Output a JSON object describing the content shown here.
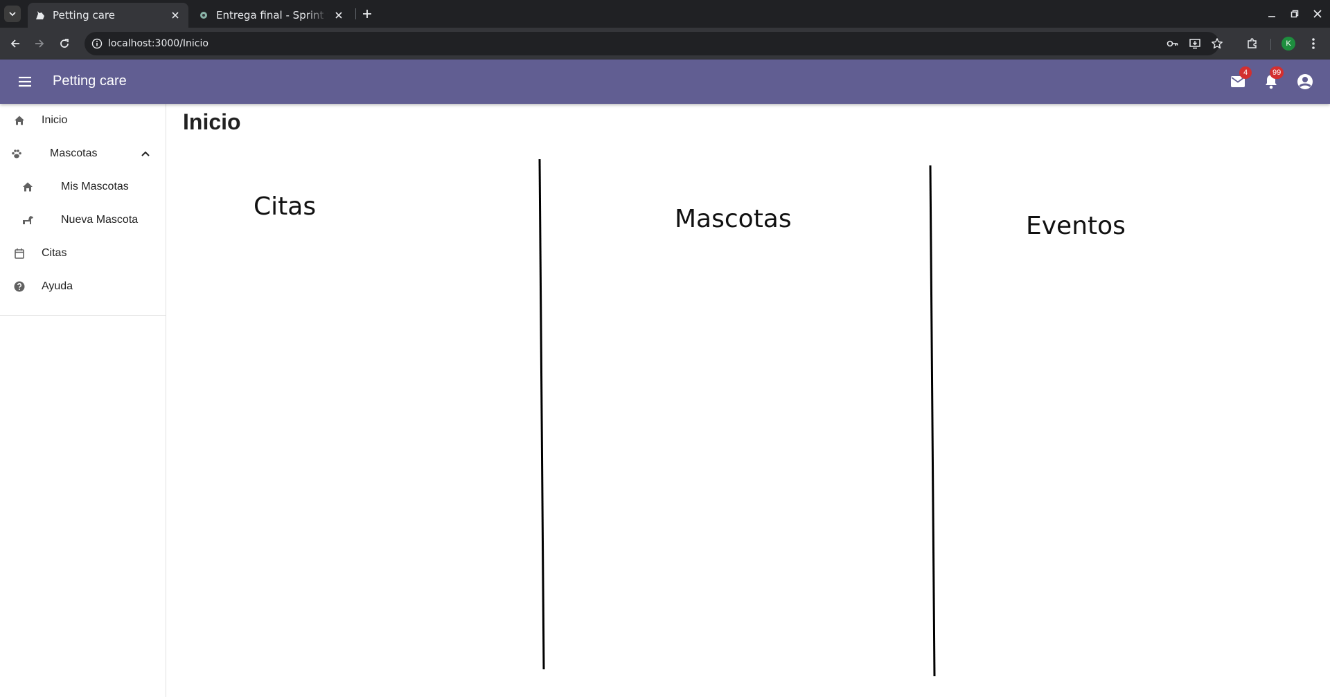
{
  "browser": {
    "tabs": [
      {
        "title": "Petting care",
        "active": true
      },
      {
        "title": "Entrega final - Sprint tas",
        "active": false
      }
    ],
    "url": "localhost:3000/Inicio",
    "profile_initial": "K"
  },
  "appbar": {
    "title": "Petting care",
    "background": "#615e92",
    "mail_badge": "4",
    "notifications_badge": "99"
  },
  "sidebar": {
    "items": [
      {
        "label": "Inicio",
        "icon": "home-icon"
      },
      {
        "label": "Mascotas",
        "icon": "paw-icon",
        "expanded": true
      },
      {
        "label": "Mis Mascotas",
        "icon": "home-icon"
      },
      {
        "label": "Nueva Mascota",
        "icon": "dog-icon"
      },
      {
        "label": "Citas",
        "icon": "calendar-icon"
      },
      {
        "label": "Ayuda",
        "icon": "help-icon"
      }
    ]
  },
  "main": {
    "page_title": "Inicio",
    "columns": [
      {
        "heading": "Citas"
      },
      {
        "heading": "Mascotas"
      },
      {
        "heading": "Eventos"
      }
    ]
  }
}
